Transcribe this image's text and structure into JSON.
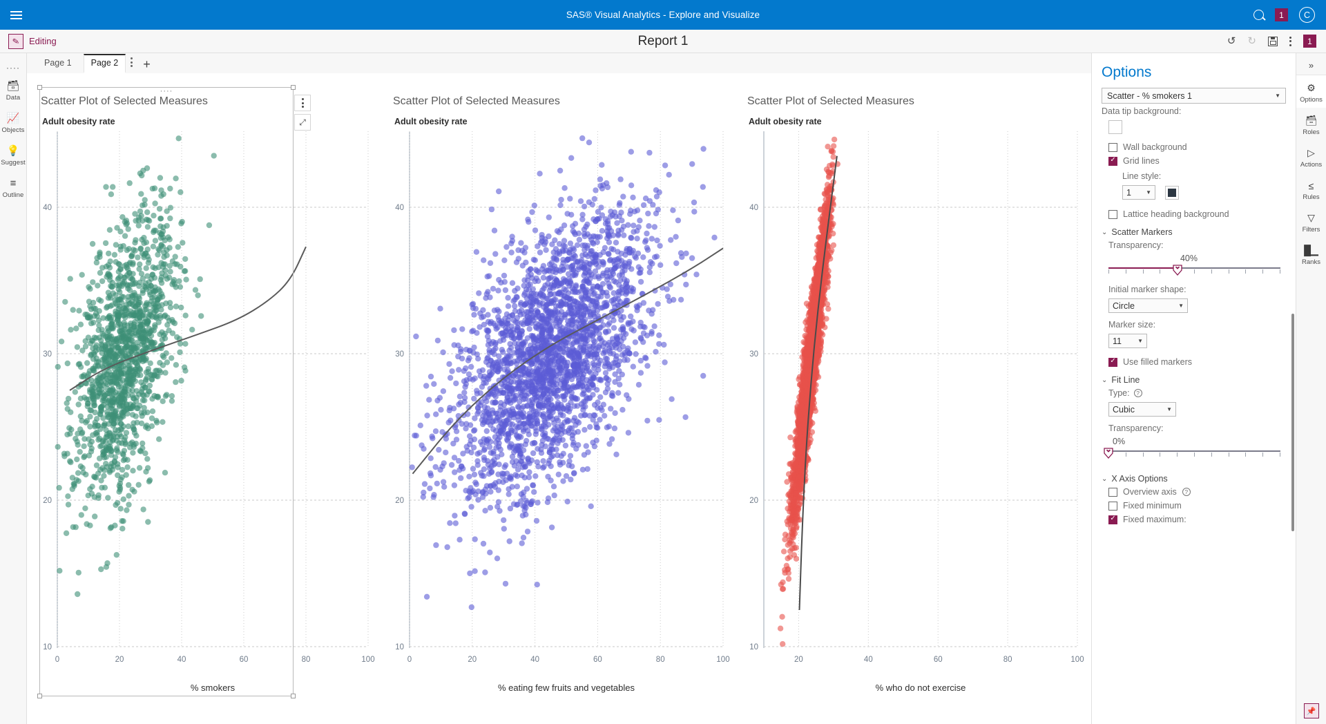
{
  "topbar": {
    "product_title": "SAS® Visual Analytics - Explore and Visualize",
    "search_icon": "search-icon",
    "notification_count": "1",
    "avatar_initial": "C"
  },
  "reportbar": {
    "mode_label": "Editing",
    "report_title": "Report 1",
    "undo_icon": "undo-icon",
    "redo_icon": "redo-icon",
    "save_icon": "save-icon",
    "more_icon": "more-menu-icon",
    "badge_count": "1"
  },
  "left_rail": {
    "handle": "····",
    "items": [
      {
        "label": "Data",
        "icon": "database-icon"
      },
      {
        "label": "Objects",
        "icon": "chart-objects-icon"
      },
      {
        "label": "Suggest",
        "icon": "lightbulb-icon"
      },
      {
        "label": "Outline",
        "icon": "outline-list-icon"
      }
    ]
  },
  "tabs": {
    "items": [
      {
        "label": "Page 1",
        "active": false
      },
      {
        "label": "Page 2",
        "active": true
      }
    ],
    "menu_icon": "tab-menu-icon",
    "add_label": "+"
  },
  "charts": [
    {
      "title": "Scatter Plot of Selected Measures",
      "y_axis_title": "Adult obesity rate",
      "x_axis_title": "% smokers",
      "color": "#3d8f77",
      "selected": true
    },
    {
      "title": "Scatter Plot of Selected Measures",
      "y_axis_title": "Adult obesity rate",
      "x_axis_title": "% eating few fruits and vegetables",
      "color": "#5b5bd6",
      "selected": false
    },
    {
      "title": "Scatter Plot of Selected Measures",
      "y_axis_title": "Adult obesity rate",
      "x_axis_title": "% who do not exercise",
      "color": "#e8514b",
      "selected": false
    }
  ],
  "chart_data": [
    {
      "type": "scatter",
      "title": "Scatter Plot of Selected Measures",
      "xlabel": "% smokers",
      "ylabel": "Adult obesity rate",
      "xlim": [
        0,
        100
      ],
      "ylim": [
        10,
        45
      ],
      "xticks": [
        0,
        20,
        40,
        60,
        80,
        100
      ],
      "yticks": [
        10,
        20,
        30,
        40
      ],
      "grid": true,
      "marker_color": "#3d8f77",
      "marker_transparency_pct": 40,
      "fit_line": {
        "type": "Cubic",
        "color": "#5a5a5a",
        "transparency_pct": 0
      },
      "cluster": {
        "x_mean": 22,
        "x_sd": 8,
        "y_mean": 30,
        "y_sd": 5,
        "n": 1400,
        "corr": 0.45
      },
      "fit_points": [
        [
          4,
          27.5
        ],
        [
          15,
          29.0
        ],
        [
          30,
          30.2
        ],
        [
          45,
          31.3
        ],
        [
          58,
          32.3
        ],
        [
          68,
          33.6
        ],
        [
          75,
          35.0
        ],
        [
          80,
          37.3
        ]
      ]
    },
    {
      "type": "scatter",
      "title": "Scatter Plot of Selected Measures",
      "xlabel": "% eating few fruits and vegetables",
      "ylabel": "Adult obesity rate",
      "xlim": [
        0,
        100
      ],
      "ylim": [
        10,
        45
      ],
      "xticks": [
        0,
        20,
        40,
        60,
        80,
        100
      ],
      "yticks": [
        10,
        20,
        30,
        40
      ],
      "grid": true,
      "marker_color": "#5b5bd6",
      "marker_transparency_pct": 40,
      "fit_line": {
        "type": "Cubic",
        "color": "#5a5a5a",
        "transparency_pct": 0
      },
      "cluster": {
        "x_mean": 45,
        "x_sd": 16,
        "y_mean": 30,
        "y_sd": 5,
        "n": 2600,
        "corr": 0.55
      },
      "fit_points": [
        [
          1,
          21.8
        ],
        [
          15,
          25.5
        ],
        [
          30,
          28.4
        ],
        [
          45,
          30.6
        ],
        [
          60,
          32.3
        ],
        [
          75,
          34.0
        ],
        [
          90,
          35.8
        ],
        [
          100,
          37.2
        ]
      ]
    },
    {
      "type": "scatter",
      "title": "Scatter Plot of Selected Measures",
      "xlabel": "% who do not exercise",
      "ylabel": "Adult obesity rate",
      "xlim": [
        10,
        100
      ],
      "ylim": [
        10,
        45
      ],
      "xticks": [
        20,
        40,
        60,
        80,
        100
      ],
      "yticks": [
        10,
        20,
        30,
        40
      ],
      "grid": true,
      "marker_color": "#e8514b",
      "marker_transparency_pct": 40,
      "fit_line": {
        "type": "Cubic",
        "color": "#4a4a4a",
        "transparency_pct": 0
      },
      "cluster": {
        "x_mean": 23.5,
        "x_sd": 2.6,
        "y_mean": 29.5,
        "y_sd": 5.2,
        "n": 3000,
        "corr": 0.93
      },
      "fit_points": [
        [
          20.2,
          12.5
        ],
        [
          21.0,
          18.0
        ],
        [
          22.0,
          23.0
        ],
        [
          23.5,
          28.0
        ],
        [
          25.5,
          33.0
        ],
        [
          28.0,
          38.0
        ],
        [
          31.0,
          43.5
        ]
      ]
    }
  ],
  "options": {
    "heading": "Options",
    "object_select": "Scatter - % smokers 1",
    "data_tip_background_label": "Data tip background:",
    "wall_background": {
      "label": "Wall background",
      "checked": false
    },
    "grid_lines": {
      "label": "Grid lines",
      "checked": true
    },
    "line_style_label": "Line style:",
    "line_style_value": "1",
    "line_color": "#2c3742",
    "lattice_heading_background": {
      "label": "Lattice heading background",
      "checked": false
    },
    "scatter_markers": {
      "section": "Scatter Markers",
      "transparency_label": "Transparency:",
      "transparency_value": "40%",
      "transparency_pct": 40,
      "initial_marker_shape_label": "Initial marker shape:",
      "initial_marker_shape_value": "Circle",
      "marker_size_label": "Marker size:",
      "marker_size_value": "11",
      "use_filled_markers": {
        "label": "Use filled markers",
        "checked": true
      }
    },
    "fit_line": {
      "section": "Fit Line",
      "type_label": "Type:",
      "type_value": "Cubic",
      "transparency_label": "Transparency:",
      "transparency_value": "0%",
      "transparency_pct": 0
    },
    "x_axis_options": {
      "section": "X Axis Options",
      "overview_axis": {
        "label": "Overview axis",
        "checked": false
      },
      "fixed_minimum": {
        "label": "Fixed minimum",
        "checked": false
      },
      "fixed_maximum": {
        "label": "Fixed maximum:",
        "checked": true
      }
    }
  },
  "right_rail": {
    "collapse_icon": "expand-collapse-icon",
    "items": [
      {
        "label": "Options",
        "icon": "options-icon",
        "selected": true
      },
      {
        "label": "Roles",
        "icon": "roles-icon",
        "selected": false
      },
      {
        "label": "Actions",
        "icon": "actions-icon",
        "selected": false
      },
      {
        "label": "Rules",
        "icon": "rules-icon",
        "selected": false
      },
      {
        "label": "Filters",
        "icon": "filter-icon",
        "selected": false
      },
      {
        "label": "Ranks",
        "icon": "ranks-icon",
        "selected": false
      }
    ],
    "pin_icon": "pin-icon"
  },
  "accent": {
    "blue": "#0379cd",
    "magenta": "#8a1b52"
  }
}
